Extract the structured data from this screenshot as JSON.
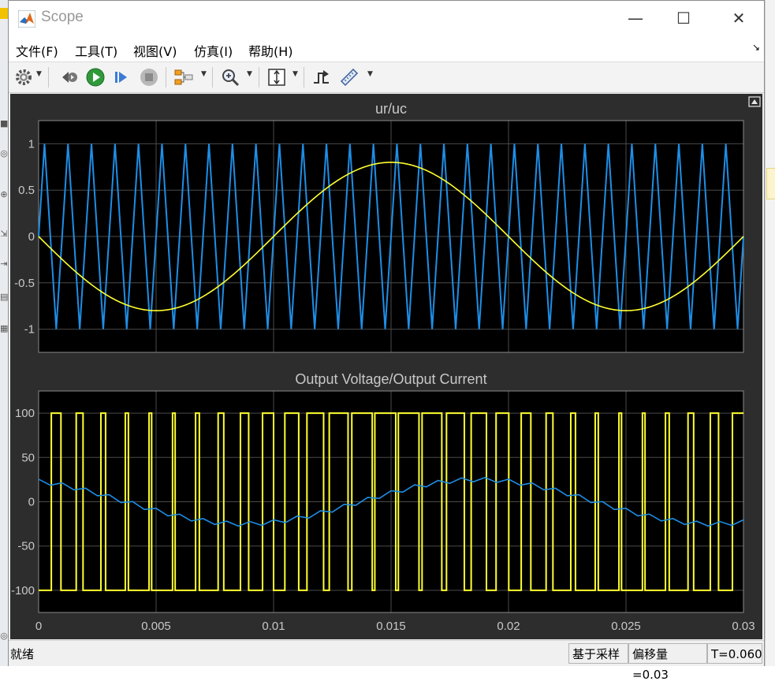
{
  "window": {
    "title": "Scope"
  },
  "menu": {
    "items": [
      "文件(F)",
      "工具(T)",
      "视图(V)",
      "仿真(I)",
      "帮助(H)"
    ]
  },
  "toolbar": {
    "icons": [
      "gear-icon",
      "step-back-icon",
      "run-icon",
      "step-forward-icon",
      "stop-icon",
      "signal-icon",
      "zoom-icon",
      "scale-axes-icon",
      "triggers-icon",
      "measure-icon"
    ]
  },
  "status": {
    "left": "就绪",
    "mode": "基于采样",
    "offset": "偏移量=0.03",
    "time": "T=0.060"
  },
  "colors": {
    "scope_bg": "#2d2d2d",
    "plot_bg": "#000000",
    "grid": "#4a4a4a",
    "yellow": "#ffff30",
    "blue": "#1e8ee6",
    "label": "#c8c8c8"
  },
  "chart_data": [
    {
      "type": "line",
      "title": "ur/uc",
      "xlim": [
        0,
        0.03
      ],
      "ylim": [
        -1.25,
        1.25
      ],
      "y_ticks": [
        "1",
        "0.5",
        "0",
        "-0.5",
        "-1"
      ],
      "grid": true,
      "series": [
        {
          "color": "#ffff30",
          "kind": "sine",
          "amplitude": 0.8,
          "frequency_hz": 50,
          "phase": "negative sine",
          "points": [
            [
              0,
              0
            ],
            [
              0.005,
              -0.8
            ],
            [
              0.01,
              0
            ],
            [
              0.015,
              0.8
            ],
            [
              0.02,
              0
            ],
            [
              0.025,
              -0.8
            ],
            [
              0.03,
              0
            ]
          ]
        },
        {
          "color": "#1e8ee6",
          "kind": "triangle",
          "amplitude": 1,
          "period_s": 0.001,
          "points": [
            [
              0,
              0
            ],
            [
              0.00025,
              1
            ],
            [
              0.00075,
              -1
            ],
            [
              0.00125,
              1
            ],
            [
              0.00175,
              -1
            ],
            [
              0.03,
              0
            ]
          ]
        }
      ]
    },
    {
      "type": "line",
      "title": "Output Voltage/Output Current",
      "xlim": [
        0,
        0.03
      ],
      "ylim": [
        -125,
        125
      ],
      "x_ticks": [
        "0",
        "0.005",
        "0.01",
        "0.015",
        "0.02",
        "0.025",
        "0.03"
      ],
      "y_ticks": [
        "100",
        "50",
        "0",
        "-50",
        "-100"
      ],
      "grid": true,
      "series": [
        {
          "color": "#ffff30",
          "kind": "spwm_voltage",
          "levels": [
            -100,
            100
          ]
        },
        {
          "color": "#1e8ee6",
          "kind": "current",
          "amplitude": 25,
          "points": [
            [
              0,
              25
            ],
            [
              0.005,
              -5
            ],
            [
              0.01,
              -25
            ],
            [
              0.015,
              5
            ],
            [
              0.019,
              25
            ],
            [
              0.025,
              -5
            ],
            [
              0.03,
              -22
            ]
          ]
        }
      ]
    }
  ]
}
